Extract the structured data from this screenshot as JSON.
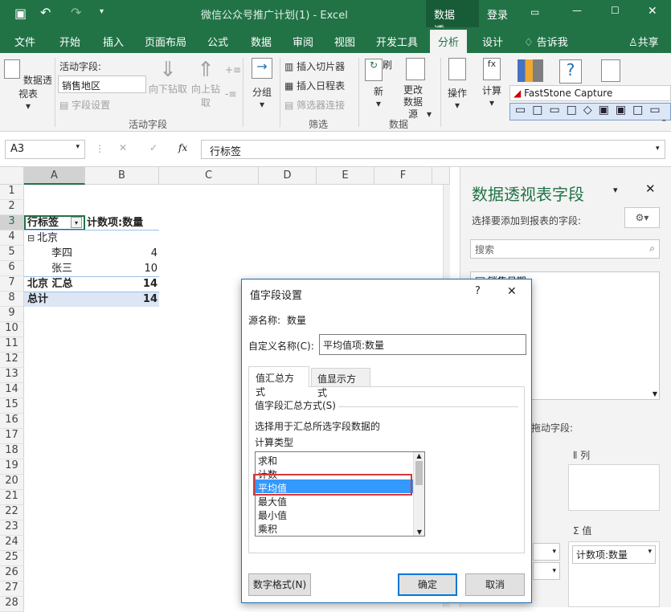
{
  "titlebar": {
    "title": "微信公众号推广计划(1)  -  Excel",
    "context_label": "数据透...",
    "login": "登录"
  },
  "tabs": [
    "文件",
    "开始",
    "插入",
    "页面布局",
    "公式",
    "数据",
    "审阅",
    "视图",
    "开发工具",
    "分析",
    "设计",
    "告诉我",
    "共享"
  ],
  "ribbon": {
    "pivot_table": "数据透视表",
    "active_field_label": "活动字段:",
    "active_field_value": "销售地区",
    "field_settings": "字段设置",
    "drill_down": "向下钻取",
    "drill_up": "向上钻取",
    "group_active": "活动字段",
    "group": "分组",
    "insert_slicer": "插入切片器",
    "insert_timeline": "插入日程表",
    "filter_conn": "筛选器连接",
    "group_filter": "筛选",
    "refresh": "刷新",
    "change_source": "更改数据源",
    "group_data": "数据",
    "actions": "操作",
    "calc": "计算",
    "faststone": "FastStone Capture"
  },
  "formula": {
    "cell": "A3",
    "value": "行标签"
  },
  "columns": [
    "A",
    "B",
    "C",
    "D",
    "E",
    "F"
  ],
  "rows": [
    "1",
    "2",
    "3",
    "4",
    "5",
    "6",
    "7",
    "8",
    "9",
    "10",
    "11",
    "12",
    "13",
    "14",
    "15",
    "16",
    "17",
    "18",
    "19",
    "20",
    "21",
    "22",
    "23",
    "24",
    "25",
    "26",
    "27",
    "28"
  ],
  "pivot": {
    "r3a": "行标签",
    "r3b": "计数项:数量",
    "r4a": "北京",
    "r5a": "李四",
    "r5b": "4",
    "r6a": "张三",
    "r6b": "10",
    "r7a": "北京 汇总",
    "r7b": "14",
    "r8a": "总计",
    "r8b": "14"
  },
  "pane": {
    "title": "数据透视表字段",
    "sub": "选择要添加到报表的字段:",
    "search": "搜索",
    "field1": "销售日期",
    "drag": "拖动字段:",
    "columns": "列",
    "values": "值",
    "value_item": "计数项:数量"
  },
  "dialog": {
    "title": "值字段设置",
    "help": "?",
    "source_label": "源名称:",
    "source_value": "数量",
    "custom_label": "自定义名称(C):",
    "custom_value": "平均值项:数量",
    "tab1": "值汇总方式",
    "tab2": "值显示方式",
    "section": "值字段汇总方式(S)",
    "desc1": "选择用于汇总所选字段数据的",
    "desc2": "计算类型",
    "options": [
      "求和",
      "计数",
      "平均值",
      "最大值",
      "最小值",
      "乘积"
    ],
    "number_format": "数字格式(N)",
    "ok": "确定",
    "cancel": "取消"
  }
}
